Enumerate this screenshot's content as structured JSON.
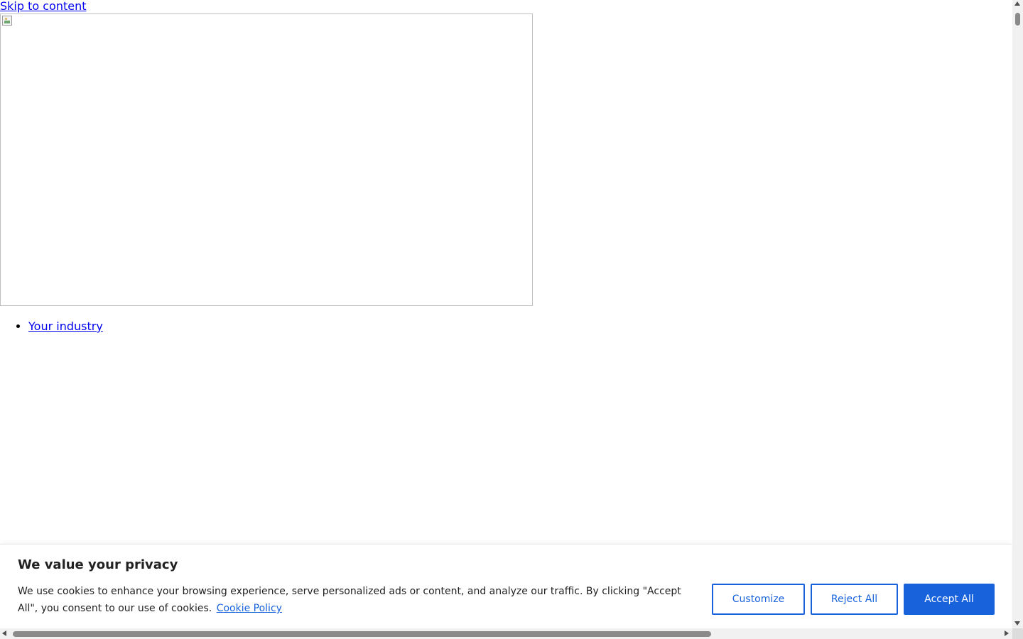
{
  "skip_link": {
    "label": "Skip to content"
  },
  "hero": {
    "image_state": "broken-image-icon"
  },
  "nav": {
    "items": [
      {
        "label": "Your industry"
      }
    ]
  },
  "cookie_banner": {
    "title": "We value your privacy",
    "text": "We use cookies to enhance your browsing experience, serve personalized ads or content, and analyze our traffic. By clicking \"Accept All\", you consent to our use of cookies.",
    "policy_link": "Cookie Policy",
    "buttons": {
      "customize": "Customize",
      "reject": "Reject All",
      "accept": "Accept All"
    },
    "colors": {
      "accent": "#1863dc",
      "text": "#212121"
    }
  }
}
